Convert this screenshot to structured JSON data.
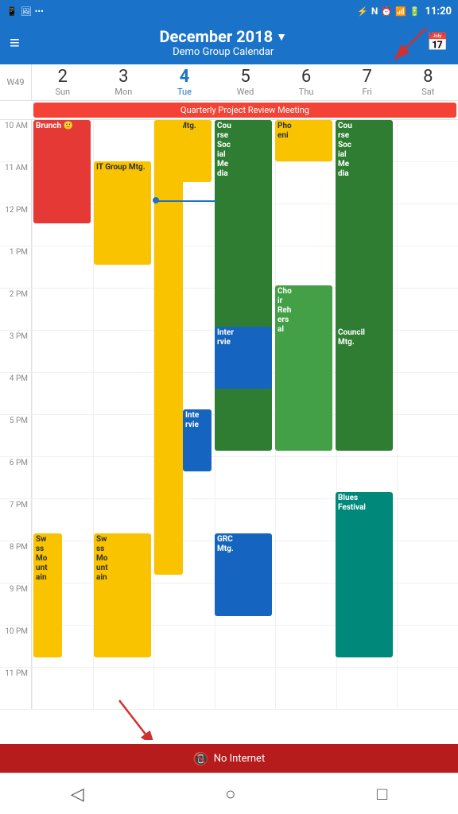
{
  "statusBar": {
    "time": "11:20",
    "icons": [
      "phone",
      "image",
      "dots",
      "bluetooth",
      "nfc",
      "alarm",
      "signal",
      "battery"
    ]
  },
  "header": {
    "title": "December 2018",
    "subtitle": "Demo Group Calendar",
    "menuIcon": "≡",
    "calIcon": "📅"
  },
  "weekRow": {
    "weekNum": "W49",
    "days": [
      {
        "num": "2",
        "name": "Sun",
        "today": false
      },
      {
        "num": "3",
        "name": "Mon",
        "today": false
      },
      {
        "num": "4",
        "name": "Tue",
        "today": true
      },
      {
        "num": "5",
        "name": "Wed",
        "today": false
      },
      {
        "num": "6",
        "name": "Thu",
        "today": false
      },
      {
        "num": "7",
        "name": "Fri",
        "today": false
      },
      {
        "num": "8",
        "name": "Sat",
        "today": false
      }
    ]
  },
  "bannerEvent": "Quarterly Project Review Meeting",
  "timeSlots": [
    "10 AM",
    "11 AM",
    "12 PM",
    "1 PM",
    "2 PM",
    "3 PM",
    "4 PM",
    "5 PM",
    "6 PM",
    "7 PM",
    "8 PM",
    "9 PM",
    "10 PM",
    "11 PM"
  ],
  "noInternet": "No Internet",
  "nav": {
    "back": "◁",
    "home": "○",
    "square": "□"
  }
}
